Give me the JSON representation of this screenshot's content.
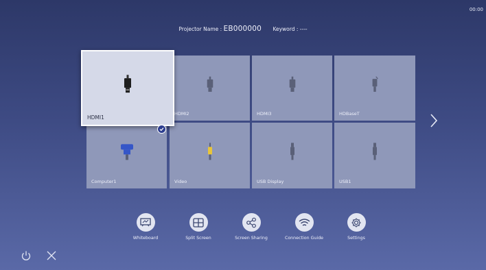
{
  "clock": "00:00",
  "header": {
    "projector_label": "Projector Name : ",
    "projector_name": "EB000000",
    "keyword_label": "Keyword : ----"
  },
  "sources": [
    {
      "label": "HDMI1",
      "icon": "hdmi-plug-icon",
      "selected": true
    },
    {
      "label": "HDMI2",
      "icon": "hdmi-plug-icon",
      "selected": false
    },
    {
      "label": "HDMI3",
      "icon": "hdmi-plug-icon",
      "selected": false
    },
    {
      "label": "HDBaseT",
      "icon": "ethernet-plug-icon",
      "selected": false
    },
    {
      "label": "Computer1",
      "icon": "vga-plug-icon",
      "selected": false
    },
    {
      "label": "Video",
      "icon": "rca-plug-icon",
      "selected": false
    },
    {
      "label": "USB Display",
      "icon": "usb-plug-icon",
      "selected": false
    },
    {
      "label": "USB1",
      "icon": "usb-plug-icon",
      "selected": false
    }
  ],
  "menu": [
    {
      "label": "Whiteboard",
      "icon": "whiteboard-icon"
    },
    {
      "label": "Split Screen",
      "icon": "split-screen-icon"
    },
    {
      "label": "Screen Sharing",
      "icon": "share-icon"
    },
    {
      "label": "Connection Guide",
      "icon": "wifi-icon"
    },
    {
      "label": "Settings",
      "icon": "gear-icon"
    }
  ],
  "colors": {
    "background_top": "#2d3868",
    "background_bottom": "#5a69a7",
    "tile": "#8f98b9",
    "tile_selected": "#d5d9e8",
    "check_badge": "#2c3d8f",
    "vga_blue": "#3556c8",
    "rca_yellow": "#e8c53a"
  }
}
